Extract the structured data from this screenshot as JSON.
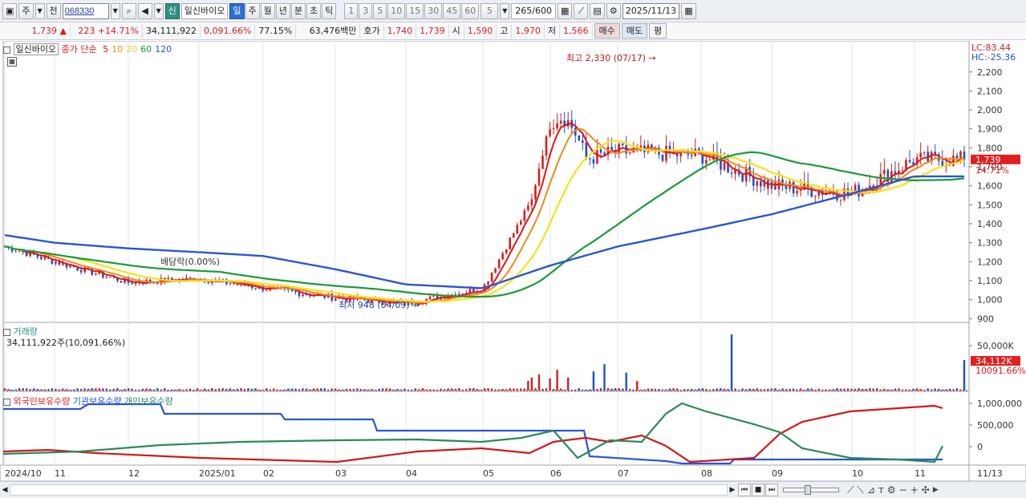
{
  "toolbar": {
    "market": "주",
    "prev_label": "전",
    "code": "068330",
    "new_badge": "신",
    "stock_name": "일신바이오",
    "periods": [
      "일",
      "주",
      "월",
      "년",
      "분",
      "초",
      "틱"
    ],
    "active_period": "일",
    "intervals": [
      "1",
      "3",
      "5",
      "10",
      "15",
      "30",
      "45",
      "60"
    ],
    "interval_select": "5",
    "count": "265",
    "max_count": "/600",
    "date": "2025/11/13"
  },
  "quote": {
    "price": "1,739",
    "change": "223",
    "change_pct": "+14.71%",
    "volume": "34,111,922",
    "volume_ratio": "0,091.66%",
    "turnover": "77.15%",
    "amount": "63,476백만",
    "hoga_label": "호가",
    "ask": "1,740",
    "bid": "1,739",
    "open_label": "시",
    "open": "1,590",
    "high_label": "고",
    "high": "1,970",
    "low_label": "저",
    "low": "1,566",
    "buy_label": "매수",
    "sell_label": "매도",
    "flat_label": "평"
  },
  "price_pane": {
    "name": "일신바이오",
    "legend_prefix": "종가 단순",
    "ma_labels": [
      "5",
      "10",
      "20",
      "60",
      "120"
    ],
    "lc": "LC:83.44",
    "hc": "HC:-25.36",
    "y_ticks": [
      "2,200",
      "2,100",
      "2,000",
      "1,900",
      "1,800",
      "1,700",
      "1,600",
      "1,500",
      "1,400",
      "1,300",
      "1,200",
      "1,100",
      "1,000",
      "900"
    ],
    "current_tag": "1,739",
    "current_pct": "14.71%",
    "high_note": "최고 2,330 (07/17)",
    "low_note": "최저 948 (04/09)",
    "dividend_note": "배당락(0.00%)"
  },
  "volume_pane": {
    "title": "거래량",
    "value": "34,111,922주(10,091.66%)",
    "y_tick": "50,000K",
    "tag": "34,112K",
    "tag_pct": "10091.66%"
  },
  "holding_pane": {
    "labels": [
      "외국인보유수량",
      "기관보유수량",
      "개인보유수량"
    ],
    "y_ticks": [
      "1,000,000",
      "500,000",
      "0"
    ]
  },
  "x_axis": {
    "labels": [
      "2024/10",
      "11",
      "12",
      "2025/01",
      "02",
      "03",
      "04",
      "05",
      "06",
      "07",
      "08",
      "09",
      "10",
      "11"
    ],
    "right_label": "11/13"
  },
  "colors": {
    "up": "#d61f1f",
    "down": "#1d4fd0",
    "ma5": "#e0161a",
    "ma10": "#f08a18",
    "ma20": "#f6e21a",
    "ma60": "#1b9a3a",
    "ma120": "#2a55d6"
  },
  "chart_data": {
    "type": "candlestick",
    "x": [
      "2024/10",
      "11",
      "12",
      "2025/01",
      "02",
      "03",
      "04",
      "05",
      "06",
      "07",
      "08",
      "09",
      "10",
      "11"
    ],
    "price_close_approx": [
      1280,
      1200,
      1090,
      1110,
      1060,
      1010,
      980,
      1060,
      1700,
      1780,
      1760,
      1600,
      1560,
      1739
    ],
    "ma120_approx": [
      1340,
      1300,
      1270,
      1250,
      1230,
      1160,
      1080,
      1060,
      1180,
      1280,
      1370,
      1450,
      1560,
      1650
    ],
    "volume_spike_latest": 34111922,
    "ylim": [
      880,
      2330
    ]
  }
}
